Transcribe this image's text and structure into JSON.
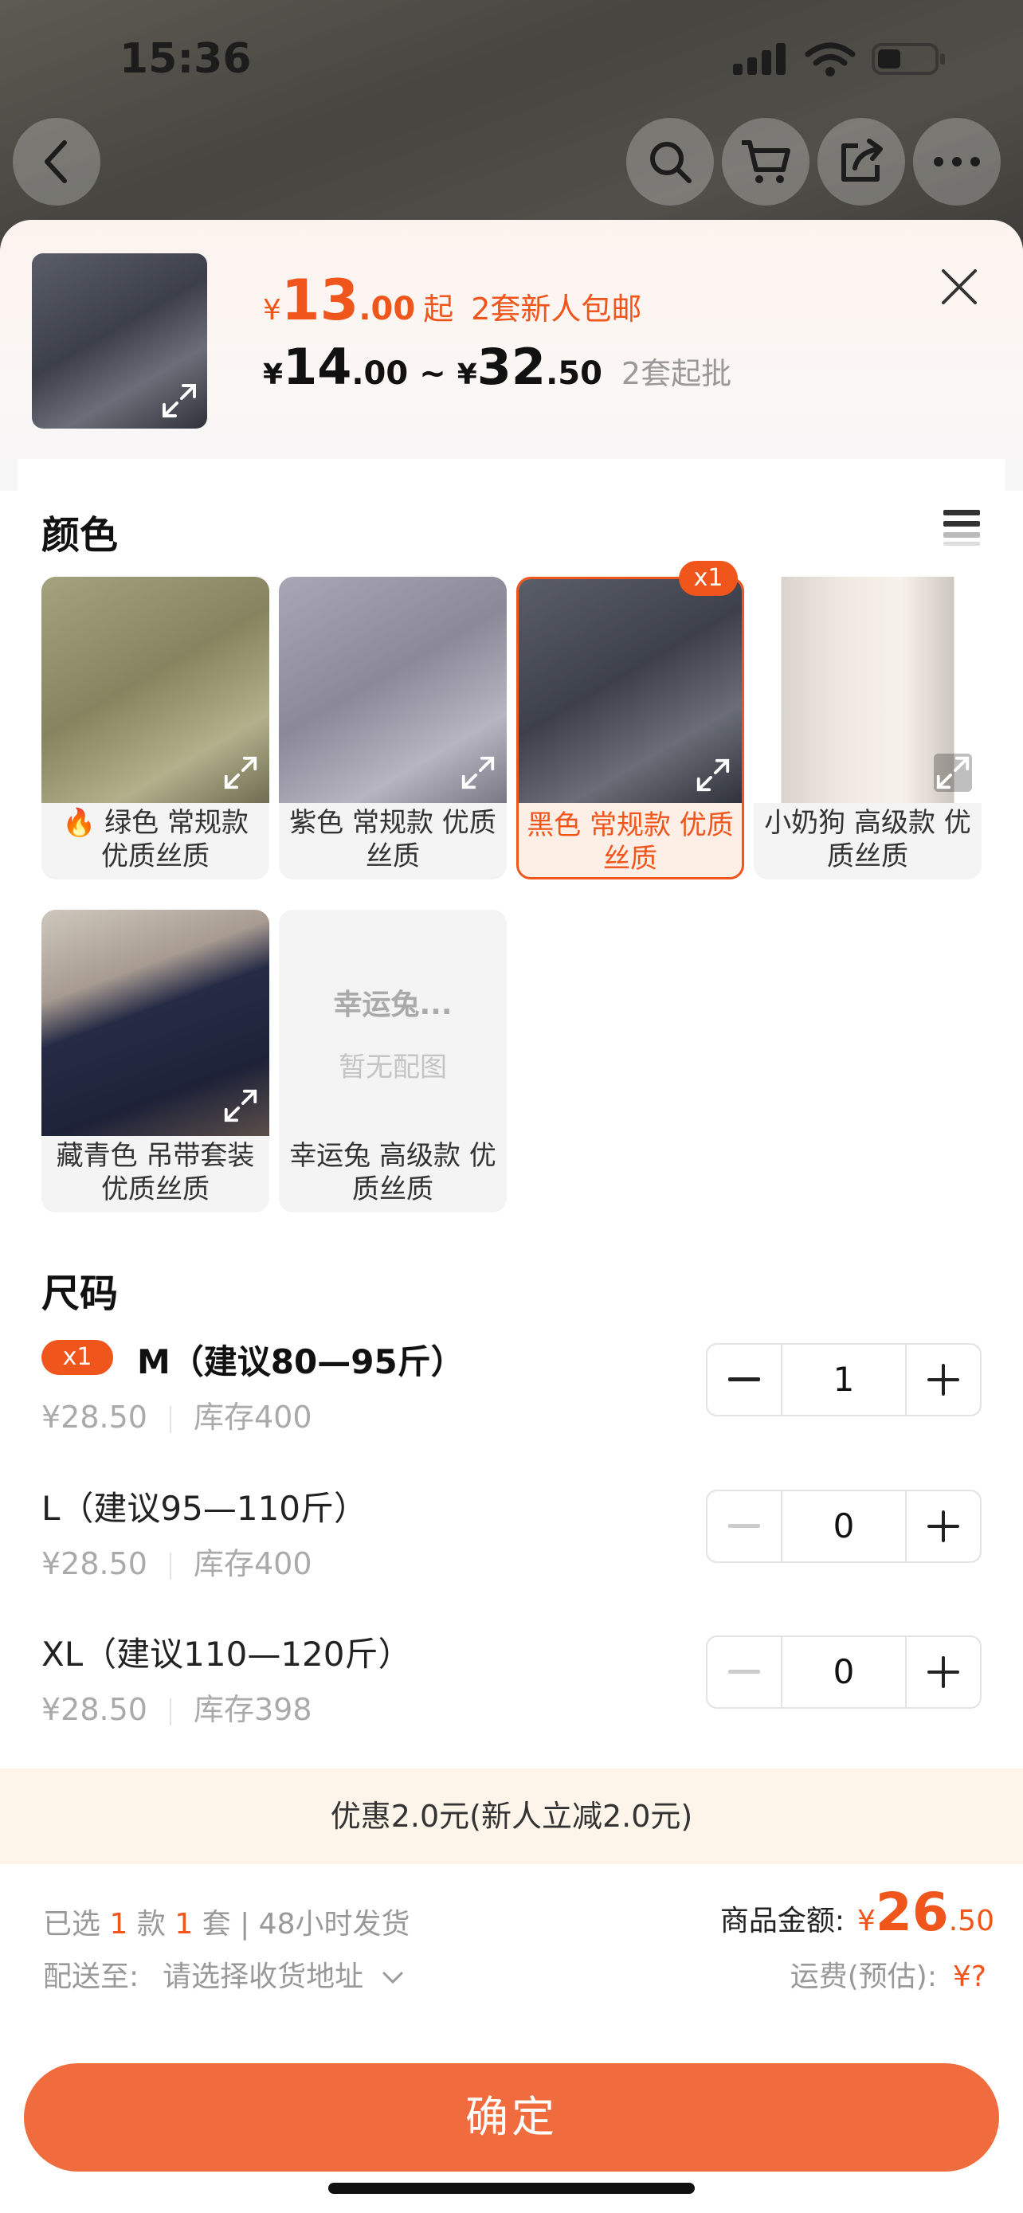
{
  "status_bar": {
    "time": "15:36"
  },
  "sheet": {
    "price_from": {
      "currency": "¥",
      "integer": "13",
      "decimal": ".00",
      "suffix": "起",
      "promo": "2套新人包邮"
    },
    "price_range": {
      "currency": "¥",
      "low_int": "14",
      "low_dec": ".00",
      "tilde": "~",
      "high_int": "32",
      "high_dec": ".50",
      "moq": "2套起批"
    }
  },
  "color_section": {
    "title": "颜色",
    "options": [
      {
        "label": "绿色 常规款 优质丝质",
        "fire_icon": "🔥",
        "selected": false
      },
      {
        "label": "紫色 常规款 优质丝质",
        "selected": false
      },
      {
        "label": "黑色 常规款 优质丝质",
        "selected": true,
        "badge": "x1"
      },
      {
        "label": "小奶狗 高级款 优质丝质",
        "selected": false
      },
      {
        "label": "藏青色 吊带套装 优质丝质",
        "selected": false
      },
      {
        "label": "幸运兔 高级款 优质丝质",
        "selected": false,
        "placeholder_title": "幸运兔...",
        "placeholder_sub": "暂无配图"
      }
    ]
  },
  "size_section": {
    "title": "尺码",
    "rows": [
      {
        "badge": "x1",
        "name": "M（建议80—95斤）",
        "price": "¥28.50",
        "stock": "库存400",
        "qty": "1"
      },
      {
        "name": "L（建议95—110斤）",
        "price": "¥28.50",
        "stock": "库存400",
        "qty": "0"
      },
      {
        "name": "XL（建议110—120斤）",
        "price": "¥28.50",
        "stock": "库存398",
        "qty": "0"
      }
    ]
  },
  "discount_bar": "优惠2.0元(新人立减2.0元)",
  "summary": {
    "selected_prefix": "已选",
    "selected_kinds": "1",
    "kinds_unit": "款",
    "selected_sets": "1",
    "sets_unit": "套 | 48小时发货",
    "ship_to_label": "配送至:",
    "ship_to_value": "请选择收货地址",
    "amount_label": "商品金额:",
    "amount_currency": "¥",
    "amount_int": "26",
    "amount_dec": ".50",
    "freight_label": "运费(预估):",
    "freight_value": "¥?"
  },
  "confirm_button": "确定",
  "colors": {
    "accent": "#f0551c",
    "button": "#f06c3e",
    "discount_bg": "#fdf5e9"
  }
}
